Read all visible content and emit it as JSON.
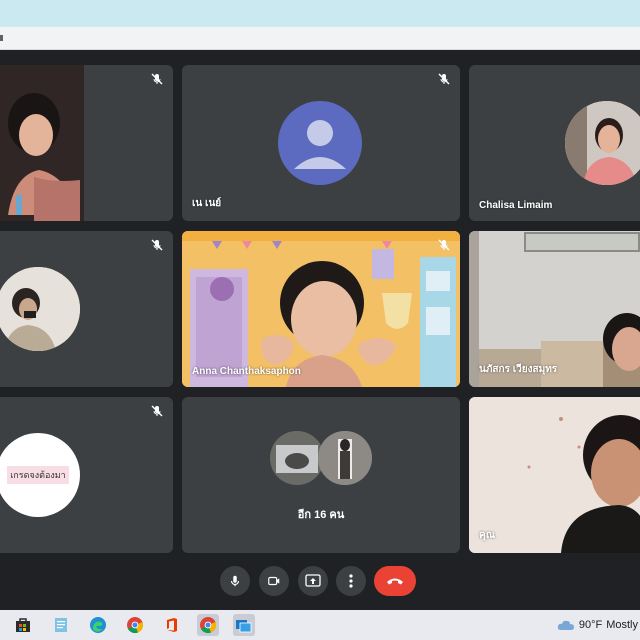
{
  "participants": [
    {
      "name": "",
      "muted": true
    },
    {
      "name": "เน เนย์",
      "muted": true
    },
    {
      "name": "Chalisa Limaim",
      "muted": false
    },
    {
      "name": "",
      "muted": true
    },
    {
      "name": "Anna Chanthaksaphon",
      "muted": true
    },
    {
      "name": "นภัสกร เวียงสมุทร",
      "muted": false
    },
    {
      "name": "",
      "muted": true,
      "tag": "เกรดจงต้องมา"
    },
    {
      "name": "อีก 16 คน",
      "muted": false
    },
    {
      "name": "คุณ",
      "muted": false
    }
  ],
  "controls": [
    "mic-icon",
    "camera-icon",
    "present-icon",
    "more-icon",
    "end-call-icon"
  ],
  "taskbar": {
    "apps": [
      "store-icon",
      "notepad-icon",
      "edge-icon",
      "chrome-icon",
      "office-icon",
      "chrome-active-icon",
      "remote-icon"
    ],
    "weather": {
      "temp": "90°F",
      "condition": "Mostly"
    }
  },
  "colors": {
    "bg": "#202124",
    "tile": "#3c4043",
    "accent": "#8ab4f8",
    "end": "#ea4335",
    "avatar": "#5c6bc0"
  }
}
